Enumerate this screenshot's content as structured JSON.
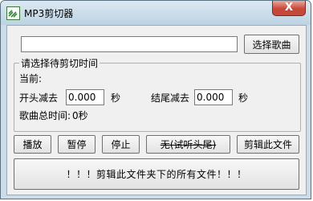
{
  "window": {
    "title": "MP3剪切器",
    "close_glyph": "X"
  },
  "file_input": {
    "value": "",
    "placeholder": ""
  },
  "buttons": {
    "select_song": "选择歌曲",
    "play": "播放",
    "pause": "暂停",
    "stop": "停止",
    "none_preview": "无(试听头尾)",
    "cut_file": "剪辑此文件",
    "cut_folder": "！！！剪辑此文件夹下的所有文件！！！"
  },
  "group": {
    "title": "请选择待剪切时间",
    "current_label": "当前:",
    "start_cut_label": "开头减去",
    "start_cut_value": "0.000",
    "end_cut_label": "结尾减去",
    "end_cut_value": "0.000",
    "seconds_unit": "秒",
    "total_time_label": "歌曲总时间:",
    "total_time_value": "0秒"
  }
}
